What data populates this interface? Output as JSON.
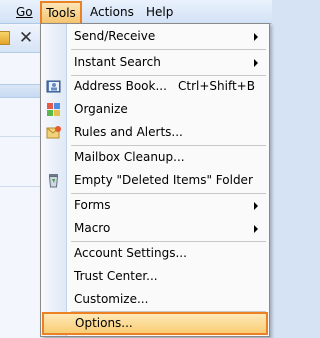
{
  "menubar": {
    "go": "Go",
    "tools": "Tools",
    "actions": "Actions",
    "help": "Help"
  },
  "toolbar": {
    "close_glyph": "✕"
  },
  "menu": {
    "items": [
      {
        "label": "Send/Receive",
        "submenu": true
      },
      {
        "label": "Instant Search",
        "submenu": true
      },
      {
        "label": "Address Book...",
        "shortcut": "Ctrl+Shift+B",
        "icon": "address-book-icon"
      },
      {
        "label": "Organize",
        "icon": "organize-icon"
      },
      {
        "label": "Rules and Alerts...",
        "icon": "rules-alerts-icon"
      },
      {
        "label": "Mailbox Cleanup..."
      },
      {
        "label": "Empty \"Deleted Items\" Folder",
        "icon": "recycle-bin-icon"
      },
      {
        "label": "Forms",
        "submenu": true
      },
      {
        "label": "Macro",
        "submenu": true
      },
      {
        "label": "Account Settings..."
      },
      {
        "label": "Trust Center..."
      },
      {
        "label": "Customize..."
      },
      {
        "label": "Options..."
      }
    ]
  },
  "colors": {
    "highlight_border": "#ea8124",
    "highlight_fill": "#f9cd74",
    "menubar_bg": "#d2e2f6"
  }
}
